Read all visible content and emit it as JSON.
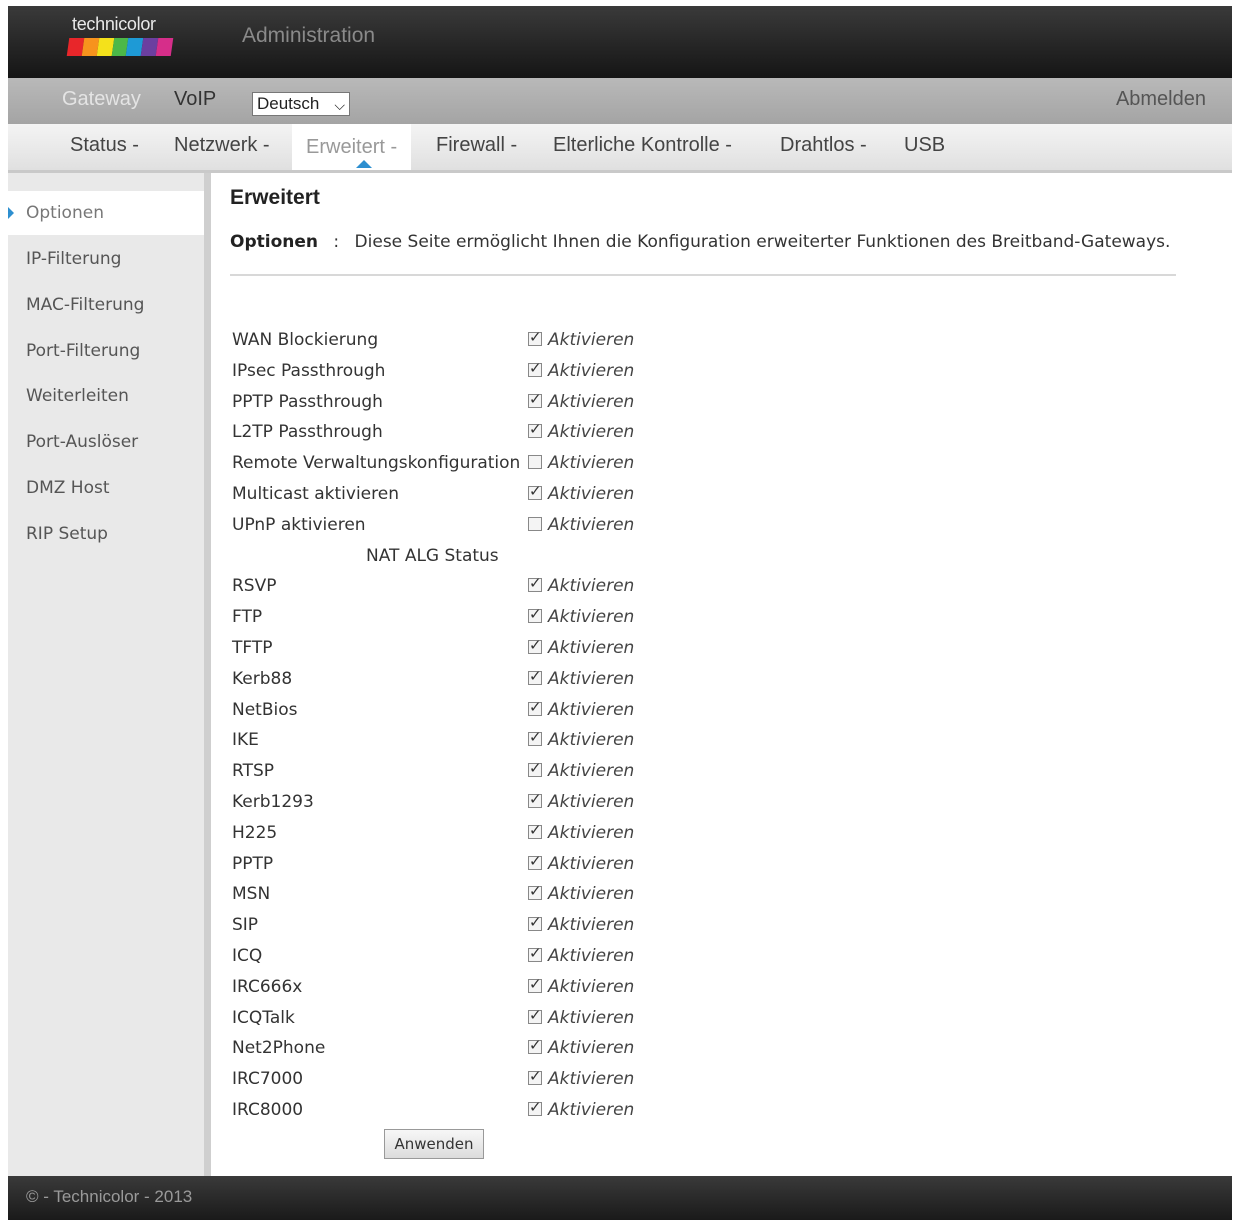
{
  "header": {
    "logo_text": "technicolor",
    "title": "Administration",
    "logo_colors": [
      "#e8262a",
      "#f7931d",
      "#f4e11b",
      "#4cb848",
      "#1e9ad6",
      "#6b3fa0",
      "#d62e8a"
    ]
  },
  "topnav": {
    "gateway": "Gateway",
    "voip": "VoIP",
    "language": "Deutsch",
    "logout": "Abmelden"
  },
  "subnav": [
    {
      "label": "Status -"
    },
    {
      "label": "Netzwerk -"
    },
    {
      "label": "Erweitert -",
      "active": true
    },
    {
      "label": "Firewall -"
    },
    {
      "label": "Elterliche Kontrolle -"
    },
    {
      "label": "Drahtlos -"
    },
    {
      "label": "USB"
    }
  ],
  "sidebar": {
    "items": [
      {
        "label": "Optionen",
        "active": true
      },
      {
        "label": "IP-Filterung"
      },
      {
        "label": "MAC-Filterung"
      },
      {
        "label": "Port-Filterung"
      },
      {
        "label": "Weiterleiten"
      },
      {
        "label": "Port-Auslöser"
      },
      {
        "label": "DMZ Host"
      },
      {
        "label": "RIP Setup"
      }
    ]
  },
  "main": {
    "title": "Erweitert",
    "intro_label": "Optionen",
    "intro_sep": ":",
    "intro_text": "Diese Seite ermöglicht Ihnen die Konfiguration erweiterter Funktionen des Breitband-Gateways.",
    "checkbox_label": "Aktivieren",
    "options": [
      {
        "label": "WAN Blockierung",
        "checked": true
      },
      {
        "label": "IPsec Passthrough",
        "checked": true
      },
      {
        "label": "PPTP Passthrough",
        "checked": true
      },
      {
        "label": "L2TP Passthrough",
        "checked": true
      },
      {
        "label": "Remote Verwaltungskonfiguration",
        "checked": false
      },
      {
        "label": "Multicast aktivieren",
        "checked": true
      },
      {
        "label": "UPnP aktivieren",
        "checked": false
      }
    ],
    "nat_title": "NAT ALG Status",
    "nat_items": [
      {
        "label": "RSVP",
        "checked": true
      },
      {
        "label": "FTP",
        "checked": true
      },
      {
        "label": "TFTP",
        "checked": true
      },
      {
        "label": "Kerb88",
        "checked": true
      },
      {
        "label": "NetBios",
        "checked": true
      },
      {
        "label": "IKE",
        "checked": true
      },
      {
        "label": "RTSP",
        "checked": true
      },
      {
        "label": "Kerb1293",
        "checked": true
      },
      {
        "label": "H225",
        "checked": true
      },
      {
        "label": "PPTP",
        "checked": true
      },
      {
        "label": "MSN",
        "checked": true
      },
      {
        "label": "SIP",
        "checked": true
      },
      {
        "label": "ICQ",
        "checked": true
      },
      {
        "label": "IRC666x",
        "checked": true
      },
      {
        "label": "ICQTalk",
        "checked": true
      },
      {
        "label": "Net2Phone",
        "checked": true
      },
      {
        "label": "IRC7000",
        "checked": true
      },
      {
        "label": "IRC8000",
        "checked": true
      }
    ],
    "apply_label": "Anwenden"
  },
  "footer": {
    "text": "© - Technicolor - 2013"
  }
}
